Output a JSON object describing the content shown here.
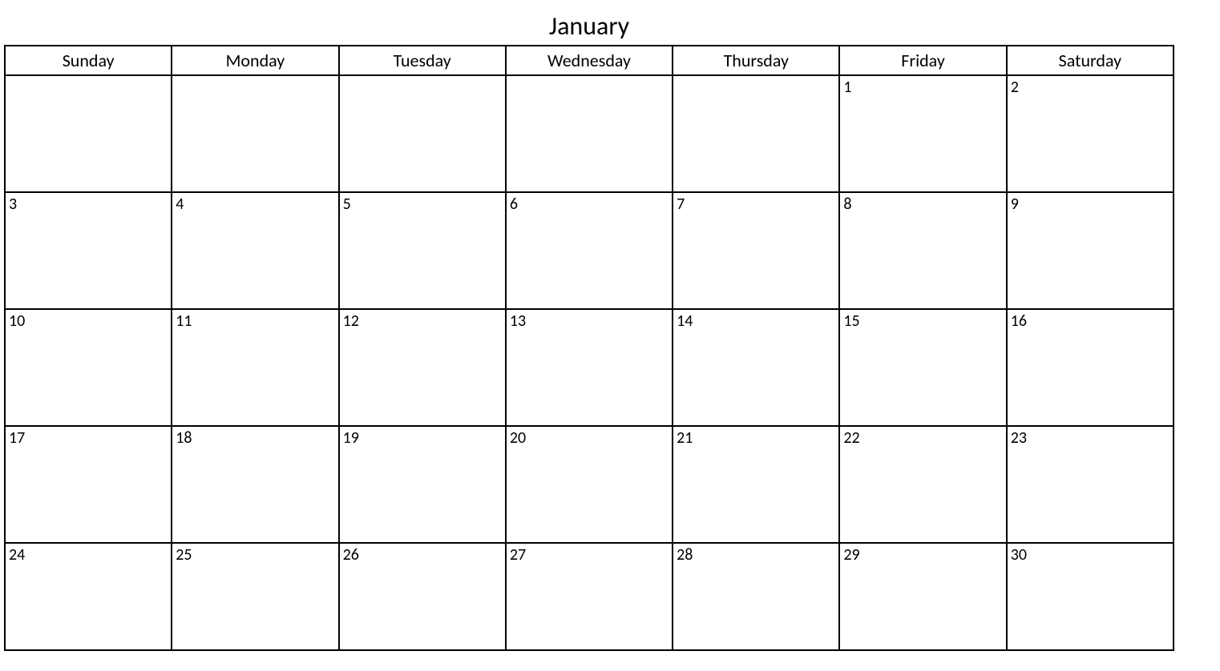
{
  "month_title": "January",
  "day_headers": [
    "Sunday",
    "Monday",
    "Tuesday",
    "Wednesday",
    "Thursday",
    "Friday",
    "Saturday"
  ],
  "weeks": [
    [
      "",
      "",
      "",
      "",
      "",
      "1",
      "2"
    ],
    [
      "3",
      "4",
      "5",
      "6",
      "7",
      "8",
      "9"
    ],
    [
      "10",
      "11",
      "12",
      "13",
      "14",
      "15",
      "16"
    ],
    [
      "17",
      "18",
      "19",
      "20",
      "21",
      "22",
      "23"
    ],
    [
      "24",
      "25",
      "26",
      "27",
      "28",
      "29",
      "30"
    ]
  ]
}
